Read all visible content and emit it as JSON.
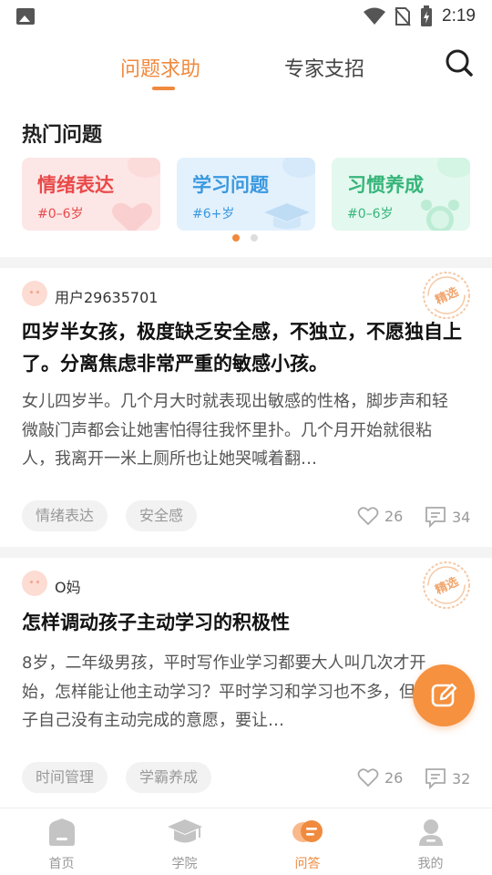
{
  "status_bar": {
    "time": "2:19"
  },
  "tabs": [
    {
      "label": "问题求助",
      "active": true
    },
    {
      "label": "专家支招",
      "active": false
    }
  ],
  "hot": {
    "title": "热门问题",
    "categories": [
      {
        "title": "情绪表达",
        "age": "#0–6岁",
        "color": "#e84a4a"
      },
      {
        "title": "学习问题",
        "age": "#6+岁",
        "color": "#3a98e0"
      },
      {
        "title": "习惯养成",
        "age": "#0–6岁",
        "color": "#36b57a"
      }
    ]
  },
  "posts": [
    {
      "user": "用户29635701",
      "badge": "精选",
      "title": "四岁半女孩，极度缺乏安全感，不独立，不愿独自上了。分离焦虑非常严重的敏感小孩。",
      "body": "女儿四岁半。几个月大时就表现出敏感的性格，脚步声和轻微敲门声都会让她害怕得往我怀里扑。几个月开始就很粘人，我离开一米上厕所也让她哭喊着翻…",
      "tags": [
        "情绪表达",
        "安全感"
      ],
      "likes": "26",
      "comments": "34"
    },
    {
      "user": "O妈",
      "badge": "精选",
      "title": "怎样调动孩子主动学习的积极性",
      "body": "8岁，二年级男孩，平时写作业学习都要大人叫几次才开始，怎样能让他主动学习？平时学习和学习也不多，但是孩子自己没有主动完成的意愿，要让…",
      "tags": [
        "时间管理",
        "学霸养成"
      ],
      "likes": "26",
      "comments": "32"
    }
  ],
  "nav": [
    {
      "label": "首页",
      "icon": "home-icon"
    },
    {
      "label": "学院",
      "icon": "academy-icon"
    },
    {
      "label": "问答",
      "icon": "qa-icon",
      "active": true
    },
    {
      "label": "我的",
      "icon": "profile-icon"
    }
  ],
  "colors": {
    "accent": "#f08a3e",
    "fab": "#f5913f"
  }
}
